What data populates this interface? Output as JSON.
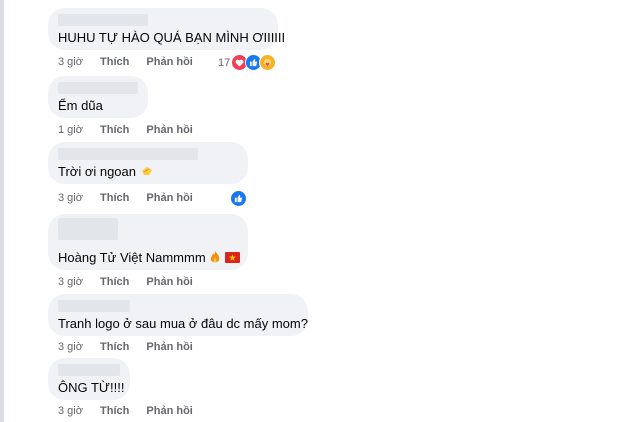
{
  "comments": [
    {
      "text": "HUHU TỰ HÀO QUÁ BẠN MÌNH ƠIIIIII",
      "time": "3 giờ",
      "like": "Thích",
      "reply": "Phản hồi",
      "reaction_count": "17"
    },
    {
      "text": "Ểm dũa",
      "time": "1 giờ",
      "like": "Thích",
      "reply": "Phản hồi"
    },
    {
      "text": "Trời ơi ngoan",
      "time": "3 giờ",
      "like": "Thích",
      "reply": "Phản hồi"
    },
    {
      "text": "Hoàng Tử Việt Nammmm",
      "time": "3 giờ",
      "like": "Thích",
      "reply": "Phản hồi"
    },
    {
      "text": "Tranh logo ở sau mua ở đâu dc mấy mom?",
      "time": "3 giờ",
      "like": "Thích",
      "reply": "Phản hồi"
    },
    {
      "text": "ÔNG TỪ!!!!",
      "time": "3 giờ",
      "like": "Thích",
      "reply": "Phản hồi"
    }
  ],
  "icons": [
    "love-reaction-icon",
    "like-reaction-icon",
    "care-reaction-icon",
    "clapping-hands-icon",
    "fire-icon",
    "vietnam-flag-icon"
  ],
  "colors": {
    "bubble": "#f0f2f5",
    "meta_text": "#65676b",
    "like_blue": "#1877f2",
    "love_red": "#f33e58",
    "flag_red": "#da251d",
    "flag_star": "#ffcd00"
  }
}
